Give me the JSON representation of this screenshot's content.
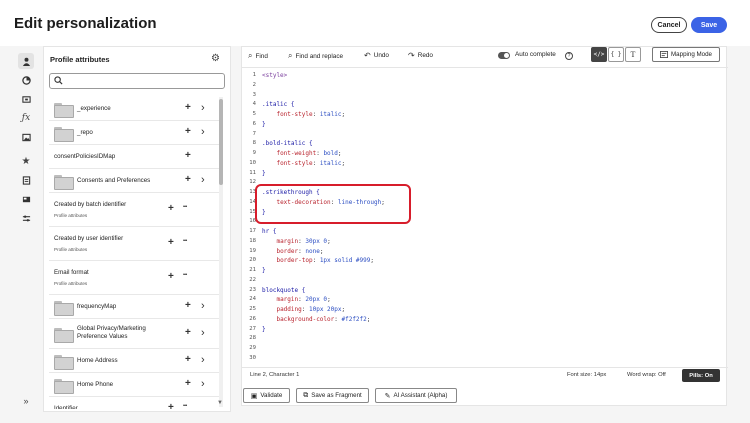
{
  "header": {
    "title": "Edit personalization",
    "cancel_label": "Cancel",
    "save_label": "Save"
  },
  "rail": {
    "icons": [
      "person-icon",
      "segment-icon",
      "offer-icon",
      "function-icon",
      "image-icon",
      "star-icon",
      "document-icon",
      "card-icon",
      "settings-icon",
      "expand-icon"
    ]
  },
  "attributes": {
    "title": "Profile attributes",
    "search_placeholder": "",
    "items": [
      {
        "label": "_experience",
        "sub": "",
        "folder": true,
        "actions": "add-chevron"
      },
      {
        "label": "_repo",
        "sub": "",
        "folder": true,
        "actions": "add-chevron"
      },
      {
        "label": "consentPoliciesIDMap",
        "sub": "",
        "folder": false,
        "actions": "add"
      },
      {
        "label": "Consents and Preferences",
        "sub": "",
        "folder": true,
        "actions": "add-chevron"
      },
      {
        "label": "Created by batch identifier",
        "sub": "Profile attributes",
        "folder": false,
        "actions": "add-more"
      },
      {
        "label": "Created by user identifier",
        "sub": "Profile attributes",
        "folder": false,
        "actions": "add-more"
      },
      {
        "label": "Email format",
        "sub": "Profile attributes",
        "folder": false,
        "actions": "add-more"
      },
      {
        "label": "frequencyMap",
        "sub": "",
        "folder": true,
        "actions": "add-chevron"
      },
      {
        "label": "Global Privacy/Marketing Preference Values",
        "sub": "",
        "folder": true,
        "actions": "add-chevron"
      },
      {
        "label": "Home Address",
        "sub": "",
        "folder": true,
        "actions": "add-chevron"
      },
      {
        "label": "Home Phone",
        "sub": "",
        "folder": true,
        "actions": "add-chevron"
      },
      {
        "label": "Identifier",
        "sub": "",
        "folder": false,
        "actions": "add-more"
      }
    ]
  },
  "toolbar": {
    "find": "Find",
    "find_replace": "Find and replace",
    "undo": "Undo",
    "redo": "Redo",
    "autocomplete": "Auto complete",
    "mode_html": "</>",
    "mode_json": "{ }",
    "mode_text": "T",
    "mapping": "Mapping Mode"
  },
  "code": {
    "lines": [
      [
        [
          "tag",
          "<style>"
        ]
      ],
      [],
      [],
      [
        [
          "sel",
          ".italic {"
        ]
      ],
      [
        [
          "plain",
          "    "
        ],
        [
          "prop",
          "font-style"
        ],
        [
          "plain",
          ": "
        ],
        [
          "val",
          "italic"
        ],
        [
          "plain",
          ";"
        ]
      ],
      [
        [
          "sel",
          "}"
        ]
      ],
      [],
      [
        [
          "sel",
          ".bold-italic {"
        ]
      ],
      [
        [
          "plain",
          "    "
        ],
        [
          "prop",
          "font-weight"
        ],
        [
          "plain",
          ": "
        ],
        [
          "val",
          "bold"
        ],
        [
          "plain",
          ";"
        ]
      ],
      [
        [
          "plain",
          "    "
        ],
        [
          "prop",
          "font-style"
        ],
        [
          "plain",
          ": "
        ],
        [
          "val",
          "italic"
        ],
        [
          "plain",
          ";"
        ]
      ],
      [
        [
          "sel",
          "}"
        ]
      ],
      [],
      [
        [
          "sel",
          ".strikethrough {"
        ]
      ],
      [
        [
          "plain",
          "    "
        ],
        [
          "prop",
          "text-decoration"
        ],
        [
          "plain",
          ": "
        ],
        [
          "val",
          "line-through"
        ],
        [
          "plain",
          ";"
        ]
      ],
      [
        [
          "sel",
          "}"
        ]
      ],
      [],
      [
        [
          "sel",
          "hr {"
        ]
      ],
      [
        [
          "plain",
          "    "
        ],
        [
          "prop",
          "margin"
        ],
        [
          "plain",
          ": "
        ],
        [
          "val",
          "30px 0"
        ],
        [
          "plain",
          ";"
        ]
      ],
      [
        [
          "plain",
          "    "
        ],
        [
          "prop",
          "border"
        ],
        [
          "plain",
          ": "
        ],
        [
          "val",
          "none"
        ],
        [
          "plain",
          ";"
        ]
      ],
      [
        [
          "plain",
          "    "
        ],
        [
          "prop",
          "border-top"
        ],
        [
          "plain",
          ": "
        ],
        [
          "val",
          "1px solid #999"
        ],
        [
          "plain",
          ";"
        ]
      ],
      [
        [
          "sel",
          "}"
        ]
      ],
      [],
      [
        [
          "sel",
          "blockquote {"
        ]
      ],
      [
        [
          "plain",
          "    "
        ],
        [
          "prop",
          "margin"
        ],
        [
          "plain",
          ": "
        ],
        [
          "val",
          "20px 0"
        ],
        [
          "plain",
          ";"
        ]
      ],
      [
        [
          "plain",
          "    "
        ],
        [
          "prop",
          "padding"
        ],
        [
          "plain",
          ": "
        ],
        [
          "val",
          "10px 20px"
        ],
        [
          "plain",
          ";"
        ]
      ],
      [
        [
          "plain",
          "    "
        ],
        [
          "prop",
          "background-color"
        ],
        [
          "plain",
          ": "
        ],
        [
          "val",
          "#f2f2f2"
        ],
        [
          "plain",
          ";"
        ]
      ],
      [
        [
          "sel",
          "}"
        ]
      ],
      [],
      [],
      []
    ]
  },
  "status": {
    "cursor": "Line 2, Character 1",
    "font_size": "Font size: 14px",
    "word_wrap": "Word wrap: Off",
    "pills": "Pills: On"
  },
  "bottom": {
    "validate": "Validate",
    "save_fragment": "Save as Fragment",
    "ai_assistant": "AI Assistant (Alpha)"
  },
  "colors": {
    "accent": "#3b63e6",
    "highlight": "#d71d2b"
  }
}
